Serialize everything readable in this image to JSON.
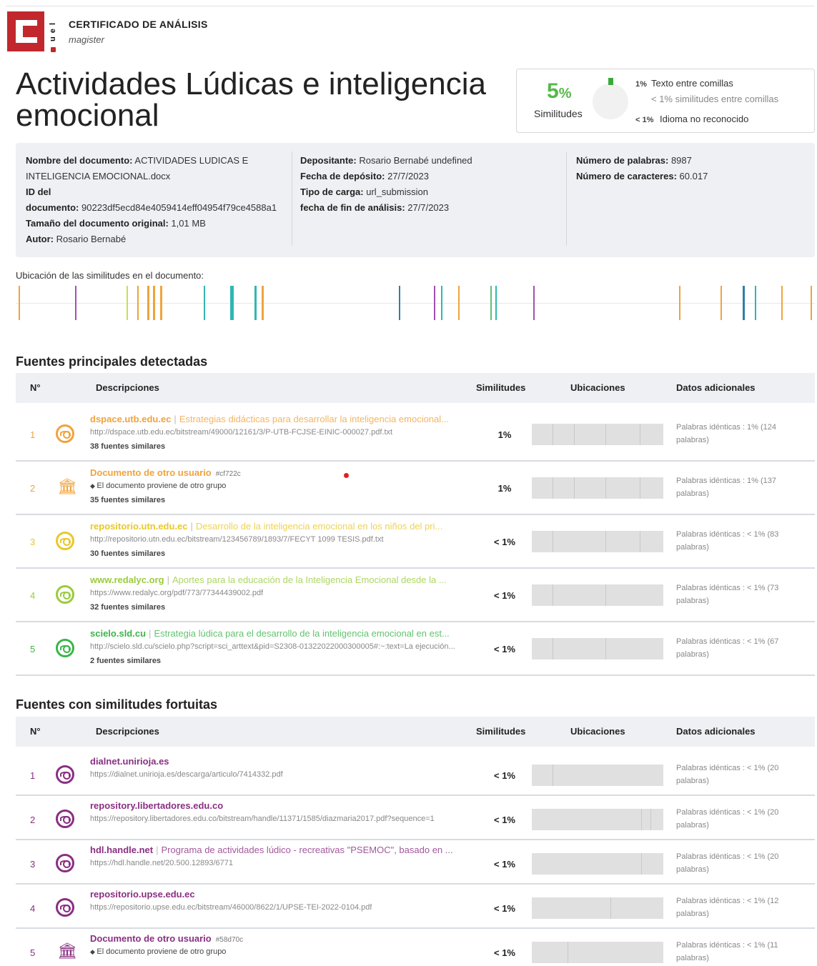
{
  "header": {
    "logo_text": "C",
    "logo_side_letters": "u e l",
    "title": "CERTIFICADO DE ANÁLISIS",
    "subtitle": "magister"
  },
  "document_title": "Actividades Lúdicas e inteligencia emocional",
  "similarity": {
    "percent": "5",
    "percent_sign": "%",
    "label": "Similitudes",
    "rows": [
      {
        "pct": "1%",
        "text": "Texto entre comillas"
      },
      {
        "pct": "",
        "text": "< 1% similitudes entre comillas"
      },
      {
        "pct": "< 1%",
        "text": "Idioma no reconocido"
      }
    ],
    "accent_color": "#55b947"
  },
  "info": {
    "col1": [
      {
        "k": "Nombre del documento:",
        "v": "ACTIVIDADES LUDICAS E"
      },
      {
        "k": "",
        "v": "INTELIGENCIA EMOCIONAL.docx"
      },
      {
        "k": "ID del",
        "v": ""
      },
      {
        "k": "documento:",
        "v": "90223df5ecd84e4059414eff04954f79ce4588a1"
      },
      {
        "k": "Tamaño del documento original:",
        "v": "1,01 MB"
      },
      {
        "k": "Autor:",
        "v": "Rosario Bernabé"
      }
    ],
    "col2": [
      {
        "k": "Depositante:",
        "v": "Rosario Bernabé undefined"
      },
      {
        "k": "Fecha de depósito:",
        "v": "27/7/2023"
      },
      {
        "k": "Tipo de carga:",
        "v": "url_submission"
      },
      {
        "k": "fecha de fin de análisis:",
        "v": "27/7/2023"
      }
    ],
    "col3": [
      {
        "k": "Número de palabras:",
        "v": "8987"
      },
      {
        "k": "Número de caracteres:",
        "v": "60.017"
      }
    ]
  },
  "locations": {
    "label": "Ubicación de las similitudes en el documento:",
    "marks": [
      {
        "pos": 0.004,
        "color": "#f0a33c",
        "w": 2
      },
      {
        "pos": 0.074,
        "color": "#a24fb5",
        "w": 2
      },
      {
        "pos": 0.139,
        "color": "#c9df4d",
        "w": 2
      },
      {
        "pos": 0.152,
        "color": "#f0a33c",
        "w": 2
      },
      {
        "pos": 0.165,
        "color": "#f0a33c",
        "w": 3
      },
      {
        "pos": 0.172,
        "color": "#f0a33c",
        "w": 3
      },
      {
        "pos": 0.181,
        "color": "#f0a33c",
        "w": 3
      },
      {
        "pos": 0.235,
        "color": "#2fb7b3",
        "w": 2
      },
      {
        "pos": 0.268,
        "color": "#2fb7b3",
        "w": 5
      },
      {
        "pos": 0.299,
        "color": "#2fb7b3",
        "w": 3
      },
      {
        "pos": 0.308,
        "color": "#f0a33c",
        "w": 3
      },
      {
        "pos": 0.479,
        "color": "#2f7fa8",
        "w": 2
      },
      {
        "pos": 0.523,
        "color": "#a24fb5",
        "w": 2
      },
      {
        "pos": 0.532,
        "color": "#2fb7b3",
        "w": 2
      },
      {
        "pos": 0.554,
        "color": "#f0a33c",
        "w": 2
      },
      {
        "pos": 0.594,
        "color": "#5cc17a",
        "w": 2
      },
      {
        "pos": 0.6,
        "color": "#2fb7b3",
        "w": 2
      },
      {
        "pos": 0.648,
        "color": "#a24fb5",
        "w": 2
      },
      {
        "pos": 0.83,
        "color": "#f0a33c",
        "w": 2
      },
      {
        "pos": 0.882,
        "color": "#f0a33c",
        "w": 2
      },
      {
        "pos": 0.91,
        "color": "#2f7fa8",
        "w": 3
      },
      {
        "pos": 0.925,
        "color": "#2fb7b3",
        "w": 2
      },
      {
        "pos": 0.958,
        "color": "#f0a33c",
        "w": 2
      },
      {
        "pos": 0.995,
        "color": "#f0a33c",
        "w": 2
      }
    ]
  },
  "table_headers": {
    "num": "N°",
    "desc": "Descripciones",
    "sim": "Similitudes",
    "loc": "Ubicaciones",
    "extra": "Datos adicionales"
  },
  "main_sources": {
    "title": "Fuentes principales detectadas",
    "rows": [
      {
        "n": "1",
        "icon": "globe",
        "color": "#f0a33c",
        "domain": "dspace.utb.edu.ec",
        "desc": "Estrategias didácticas para desarrollar la inteligencia emocional...",
        "url": "http://dspace.utb.edu.ec/bitstream/49000/12161/3/P-UTB-FCJSE-EINIC-000027.pdf.txt",
        "similar": "38 fuentes similares",
        "pct": "1%",
        "extra": "Palabras idénticas : 1% (124 palabras)",
        "ticks": [
          0.16,
          0.32,
          0.56,
          0.82
        ]
      },
      {
        "n": "2",
        "icon": "bank",
        "color": "#f0a33c",
        "domain": "Documento de otro usuario",
        "hash": "#cf722c",
        "note": "El documento proviene de otro grupo",
        "similar": "35 fuentes similares",
        "pct": "1%",
        "extra": "Palabras idénticas : 1% (137 palabras)",
        "ticks": [
          0.16,
          0.32,
          0.56,
          0.82
        ]
      },
      {
        "n": "3",
        "icon": "globe",
        "color": "#e9c829",
        "domain": "repositorio.utn.edu.ec",
        "desc": "Desarrollo de la inteligencia emocional en los niños del pri...",
        "url": "http://repositorio.utn.edu.ec/bitstream/123456789/1893/7/FECYT 1099 TESIS.pdf.txt",
        "similar": "30 fuentes similares",
        "pct": "< 1%",
        "extra": "Palabras idénticas : < 1% (83 palabras)",
        "ticks": [
          0.16,
          0.56,
          0.82
        ]
      },
      {
        "n": "4",
        "icon": "globe",
        "color": "#9acb3c",
        "domain": "www.redalyc.org",
        "desc": "Aportes para la educación de la Inteligencia Emocional desde la ...",
        "url": "https://www.redalyc.org/pdf/773/77344439002.pdf",
        "similar": "32 fuentes similares",
        "pct": "< 1%",
        "extra": "Palabras idénticas : < 1% (73 palabras)",
        "ticks": [
          0.16,
          0.56
        ]
      },
      {
        "n": "5",
        "icon": "globe",
        "color": "#3bb54a",
        "domain": "scielo.sld.cu",
        "desc": "Estrategia lúdica para el desarrollo de la inteligencia emocional en est...",
        "url": "http://scielo.sld.cu/scielo.php?script=sci_arttext&pid=S2308-01322022000300005#:~:text=La ejecución...",
        "similar": "2 fuentes similares",
        "pct": "< 1%",
        "extra": "Palabras idénticas : < 1% (67 palabras)",
        "ticks": [
          0.16,
          0.56
        ]
      }
    ]
  },
  "fortuitous_sources": {
    "title": "Fuentes con similitudes fortuitas",
    "rows": [
      {
        "n": "1",
        "icon": "globe",
        "color": "#8a2f82",
        "domain": "dialnet.unirioja.es",
        "url": "https://dialnet.unirioja.es/descarga/articulo/7414332.pdf",
        "pct": "< 1%",
        "extra": "Palabras idénticas : < 1% (20 palabras)",
        "ticks": [
          0.16
        ]
      },
      {
        "n": "2",
        "icon": "globe",
        "color": "#8a2f82",
        "domain": "repository.libertadores.edu.co",
        "url": "https://repository.libertadores.edu.co/bitstream/handle/11371/1585/diazmaria2017.pdf?sequence=1",
        "pct": "< 1%",
        "extra": "Palabras idénticas : < 1% (20 palabras)",
        "ticks": [
          0.83,
          0.9
        ]
      },
      {
        "n": "3",
        "icon": "globe",
        "color": "#8a2f82",
        "domain": "hdl.handle.net",
        "desc": "Programa de actividades lúdico - recreativas \"PSEMOC\", basado en ...",
        "url": "https://hdl.handle.net/20.500.12893/6771",
        "pct": "< 1%",
        "extra": "Palabras idénticas : < 1% (20 palabras)",
        "ticks": [
          0.83
        ]
      },
      {
        "n": "4",
        "icon": "globe",
        "color": "#8a2f82",
        "domain": "repositorio.upse.edu.ec",
        "url": "https://repositorio.upse.edu.ec/bitstream/46000/8622/1/UPSE-TEI-2022-0104.pdf",
        "pct": "< 1%",
        "extra": "Palabras idénticas : < 1% (12 palabras)",
        "ticks": [
          0.6
        ]
      },
      {
        "n": "5",
        "icon": "bank",
        "color": "#8a2f82",
        "domain": "Documento de otro usuario",
        "hash": "#58d70c",
        "note": "El documento proviene de otro grupo",
        "pct": "< 1%",
        "extra": "Palabras idénticas : < 1% (11 palabras)",
        "ticks": [
          0.27
        ]
      }
    ]
  }
}
